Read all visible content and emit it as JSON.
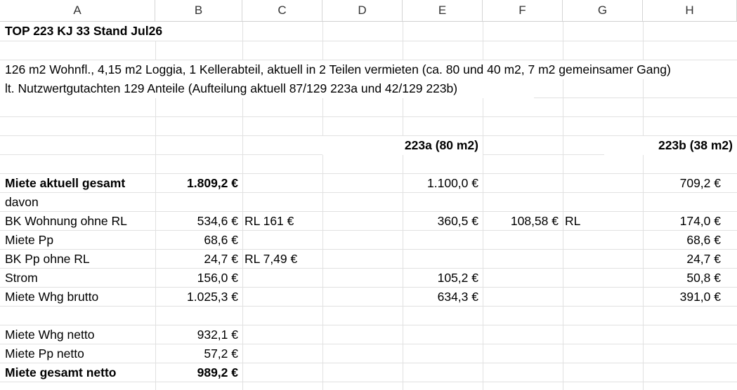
{
  "columns": [
    "A",
    "B",
    "C",
    "D",
    "E",
    "F",
    "G",
    "H"
  ],
  "rows": {
    "title": "TOP 223 KJ 33 Stand Jul26",
    "desc1": "126 m2 Wohnfl., 4,15 m2 Loggia, 1 Kellerabteil, aktuell in 2 Teilen vermieten (ca. 80 und 40 m2, 7 m2 gemeinsamer Gang)",
    "desc2": "lt. Nutzwertgutachten 129 Anteile (Aufteilung aktuell 87/129 223a und 42/129 223b)",
    "head_e": "223a (80 m2)",
    "head_h": "223b (38 m2)",
    "r1": {
      "a": "Miete aktuell gesamt",
      "b": "1.809,2 €",
      "e": "1.100,0 €",
      "h": "709,2 €"
    },
    "r2": {
      "a": "davon"
    },
    "r3": {
      "a": "BK Wohnung ohne RL",
      "b": "534,6 €",
      "c": "RL 161 €",
      "e": "360,5 €",
      "f": "108,58 €",
      "g": "RL",
      "h": "174,0 €"
    },
    "r4": {
      "a": "Miete Pp",
      "b": "68,6 €",
      "h": "68,6 €"
    },
    "r5": {
      "a": "BK Pp ohne RL",
      "b": "24,7 €",
      "c": "RL 7,49 €",
      "h": "24,7 €"
    },
    "r6": {
      "a": "Strom",
      "b": "156,0 €",
      "e": "105,2 €",
      "h": "50,8 €"
    },
    "r7": {
      "a": "Miete Whg brutto",
      "b": "1.025,3 €",
      "e": "634,3 €",
      "h": "391,0 €"
    },
    "r8": {
      "a": "Miete Whg netto",
      "b": "932,1 €"
    },
    "r9": {
      "a": "Miete Pp netto",
      "b": "57,2 €"
    },
    "r10": {
      "a": "Miete gesamt netto",
      "b": "989,2 €"
    }
  }
}
